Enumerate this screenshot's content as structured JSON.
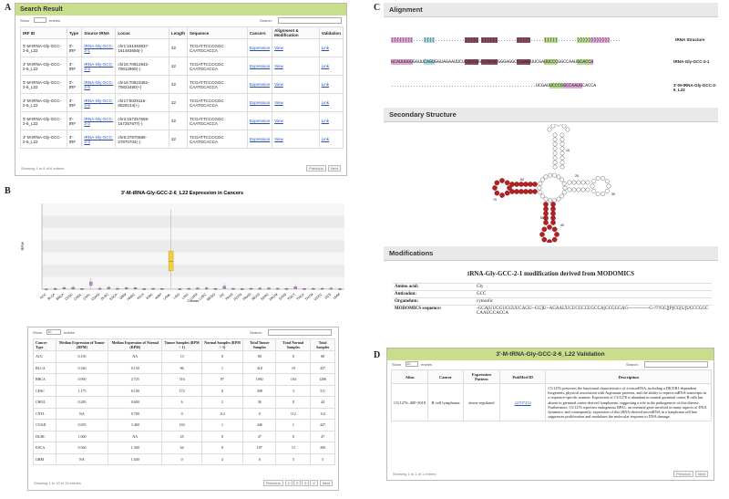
{
  "panels": {
    "a": "A",
    "b": "B",
    "c": "C",
    "d": "D"
  },
  "search_result": {
    "title": "Search Result",
    "show_label": "Show",
    "entries_label": "entries",
    "search_label": "Search:",
    "columns": [
      "tRF ID",
      "Type",
      "Source tRNA",
      "Locus",
      "Length",
      "Sequence",
      "Cancers",
      "Alignment & Modification",
      "Validation"
    ],
    "rows": [
      {
        "id": "3'-M-tRNA-Gly-GCC-2-6_L22",
        "type": "3'-tRF",
        "source": "tRNA-Gly-GCC-2-1",
        "locus": "chr1:161493637-161493655(-)",
        "len": "22",
        "seq": "TCGATTCCCGGC CAATGCACCA",
        "cancers": "Expression",
        "align": "View",
        "valid": "Link"
      },
      {
        "id": "3'-M-tRNA-Gly-GCC-2-6_L22",
        "type": "3'-tRF",
        "source": "tRNA-Gly-GCC-2-4",
        "locus": "chr16:70812942-70812960(-)",
        "len": "22",
        "seq": "TCGATTCCCGGC CAATGCACCA",
        "cancers": "Expression",
        "align": "View",
        "valid": "Link"
      },
      {
        "id": "3'-M-tRNA-Gly-GCC-2-6_L22",
        "type": "3'-tRF",
        "source": "tRNA-Gly-GCC-2-5",
        "locus": "chr16:70823462-70823480(+)",
        "len": "22",
        "seq": "TCGATTCCCGGC CAATGCACCA",
        "cancers": "Expression",
        "align": "View",
        "valid": "Link"
      },
      {
        "id": "3'-M-tRNA-Gly-GCC-2-6_L22",
        "type": "3'-tRF",
        "source": "tRNA-Gly-GCC-2-6",
        "locus": "chr17:8029116-8029134(+)",
        "len": "22",
        "seq": "TCGATTCCCGGC CAATGCACCA",
        "cancers": "Expression",
        "align": "View",
        "valid": "Link"
      },
      {
        "id": "3'-M-tRNA-Gly-GCC-2-6_L22",
        "type": "3'-tRF",
        "source": "tRNA-Gly-GCC-2-2",
        "locus": "chr2:157257659-157257677(-)",
        "len": "22",
        "seq": "TCGATTCCCGGC CAATGCACCA",
        "cancers": "Expression",
        "align": "View",
        "valid": "Link"
      },
      {
        "id": "3'-M-tRNA-Gly-GCC-2-6_L22",
        "type": "3'-tRF",
        "source": "tRNA-Gly-GCC-2-3",
        "locus": "chr6:27870686-27870704(-)",
        "len": "22",
        "seq": "TCGATTCCCGGC CAATGCACCA",
        "cancers": "Expression",
        "align": "View",
        "valid": "Link"
      }
    ],
    "info": "Showing 1 to 6 of 6 entries",
    "prev": "Previous",
    "next": "Next"
  },
  "chart_data": {
    "type": "box",
    "title": "3'-M-tRNA-Gly-GCC-2-6_L22 Expression in Cancers",
    "xlabel": "Cancer",
    "ylabel": "RPM",
    "ylim": [
      0,
      140
    ],
    "categories": [
      "ACC",
      "BLCA",
      "BRCA",
      "CESC",
      "CHOL",
      "CNTL",
      "COAD",
      "DLBC",
      "ESCA",
      "GBM",
      "HNSC",
      "KICH",
      "KIRC",
      "KIRP",
      "LAML",
      "LGG",
      "LIHC",
      "LUAD",
      "LUSC",
      "MESO",
      "OV",
      "PAAD",
      "PCPG",
      "PRAD",
      "READ",
      "SARC",
      "SKCM",
      "STAD",
      "TGCT",
      "THCA",
      "THYM",
      "UCEC",
      "UCS",
      "UVM"
    ],
    "medians": [
      0.15,
      0.32,
      0.95,
      1.18,
      0.29,
      9.7,
      0.65,
      1.6,
      0.56,
      1.04,
      1.1,
      0.3,
      0.5,
      0.4,
      45,
      0.3,
      0.5,
      0.8,
      0.9,
      0.4,
      2.5,
      0.5,
      0.3,
      0.6,
      0.7,
      0.8,
      0.6,
      0.5,
      1.8,
      0.4,
      0.5,
      0.6,
      0.7,
      0.3
    ],
    "q1": [
      0,
      0,
      0.3,
      0.4,
      0,
      6,
      0.2,
      0.5,
      0.2,
      0.4,
      0.4,
      0,
      0.1,
      0.1,
      30,
      0.1,
      0.2,
      0.3,
      0.3,
      0.1,
      1,
      0.1,
      0.1,
      0.2,
      0.2,
      0.3,
      0.2,
      0.2,
      0.6,
      0.1,
      0.1,
      0.2,
      0.2,
      0.1
    ],
    "q3": [
      0.5,
      1,
      2.5,
      3,
      1,
      12,
      1.5,
      3,
      1.3,
      2.5,
      2.5,
      0.8,
      1.2,
      1,
      62,
      0.8,
      1.2,
      1.8,
      2,
      1,
      5,
      1.2,
      0.8,
      1.4,
      1.6,
      1.8,
      1.4,
      1.2,
      4,
      1,
      1.2,
      1.4,
      1.6,
      0.8
    ],
    "whisker_high": [
      1.5,
      3,
      6,
      6,
      2,
      18,
      4,
      6,
      4,
      5,
      5,
      2,
      3,
      2.5,
      130,
      2,
      3,
      4,
      5,
      2.5,
      10,
      3,
      2,
      3,
      4,
      4,
      3,
      3,
      8,
      2.5,
      3,
      3,
      4,
      2
    ]
  },
  "expression_table": {
    "show_label": "Show",
    "show_value": "10",
    "entries_label": "entries",
    "search_label": "Search:",
    "columns": [
      "Cancer Type",
      "Median Expression of Tumor (RPM)",
      "Median Expression of Normal (RPM)",
      "Tumor Samples (RPM > 1)",
      "Normal Samples (RPM > 1)",
      "Total Tumor Samples",
      "Total Normal Samples",
      "Total Samples"
    ],
    "rows": [
      [
        "ACC",
        "0.150",
        "NA",
        "13",
        "0",
        "80",
        "0",
        "80"
      ],
      [
        "BLCA",
        "0.320",
        "0.150",
        "86",
        "1",
        "418",
        "19",
        "437"
      ],
      [
        "BRCA",
        "0.950",
        "2.725",
        "516",
        "87",
        "1092",
        "104",
        "1206"
      ],
      [
        "CESC",
        "1.175",
        "0.100",
        "172",
        "0",
        "308",
        "3",
        "311"
      ],
      [
        "CHOL",
        "0.285",
        "0.600",
        "6",
        "2",
        "36",
        "8",
        "44"
      ],
      [
        "CNTL",
        "NA",
        "9.700",
        "0",
        "112",
        "0",
        "112",
        "112"
      ],
      [
        "COAD",
        "0.655",
        "3.460",
        "163",
        "1",
        "446",
        "1",
        "447"
      ],
      [
        "DLBC",
        "1.600",
        "NA",
        "25",
        "0",
        "47",
        "0",
        "47"
      ],
      [
        "ESCA",
        "0.560",
        "1.300",
        "64",
        "8",
        "187",
        "13",
        "200"
      ],
      [
        "GBM",
        "NA",
        "1.040",
        "0",
        "4",
        "0",
        "5",
        "5"
      ]
    ],
    "info": "Showing 1 to 10 of 34 entries",
    "prev": "Previous",
    "pages": [
      "1",
      "2",
      "3",
      "4"
    ],
    "next": "Next"
  },
  "alignment": {
    "title": "Alignment",
    "structure_line": "((((((((....((((...........))))).((((((.......))))).....(((((.......))))))))))))....",
    "structure_label": "tRNA Structure",
    "trna_seq": "GCAUUGGUGGUUCAGUGGUAGAAUUCUCGCCUGCCACGCGGGAGGCCCGGGUUCGAUUCCCGGCCAAUGCACCA",
    "trna_label": "tRNA-Gly-GCC-2-1",
    "trf_dots": ".....................................................",
    "trf_seq": "UCGAUUCCCGGCCAAUGCACCA",
    "trf_label": "3'-M-tRNA-Gly-GCC-2-6_L22"
  },
  "secondary_structure": {
    "title": "Secondary Structure",
    "labels": [
      "10",
      "20",
      "30",
      "40",
      "50",
      "60",
      "70"
    ]
  },
  "modifications": {
    "title": "Modifications",
    "heading": "tRNA-Gly-GCC-2-1 modification derived from MODOMICS",
    "rows": [
      {
        "key": "Amino acid:",
        "val": "Gly"
      },
      {
        "key": "Anticodon:",
        "val": "GCC"
      },
      {
        "key": "Organelum:",
        "val": "cytosolic"
      },
      {
        "key": "MODOMICS sequence:",
        "val": "-GCA[UUGGUGGUUCAGU--GG]U--AGAAUUCUCGCCUGCCA[GCGGGAG--------------G-???GG[[P]CG[U]UCCCGGCCAAUGCACCA"
      }
    ]
  },
  "validation": {
    "title": "3'-M-tRNA-Gly-GCC-2-6_L22 Validation",
    "show_label": "Show",
    "show_value": "10",
    "entries_label": "entries",
    "search_label": "Search:",
    "columns": [
      "Alias",
      "Cancer",
      "Expression Pattern",
      "PubMed ID",
      "Description"
    ],
    "rows": [
      {
        "alias": "CU1276; tRF-3018",
        "cancer": "B cell lymphoma",
        "pattern": "down-regulated",
        "pmid": "22707232",
        "desc": "CU1276 possesses the functional characteristics of a microRNA, including a DICER1-dependent biogenesis, physical association with Argonaute proteins, and the ability to repress mRNA transcripts in a sequence-specific manner. Expression of CU1276 is abundant in normal germinal center B cells but absent in germinal center-derived lymphomas, suggesting a role in the pathogenesis of this disease. Furthermore, CU1276 represses endogenous RPA1, an essential gene involved in many aspects of DNA dynamics, and consequently, expression of this tRNA-derived microRNA in a lymphoma cell line suppresses proliferation and modulates the molecular response to DNA damage."
      }
    ],
    "info": "Showing 1 to 1 of 1 entries",
    "prev": "Previous",
    "next": "Next"
  },
  "colors": {
    "header_green": "#c8de8a",
    "link": "#2a4fb0",
    "box_fill": "#f4d03f",
    "violin": "#c59ad0",
    "node_red": "#b22222"
  }
}
